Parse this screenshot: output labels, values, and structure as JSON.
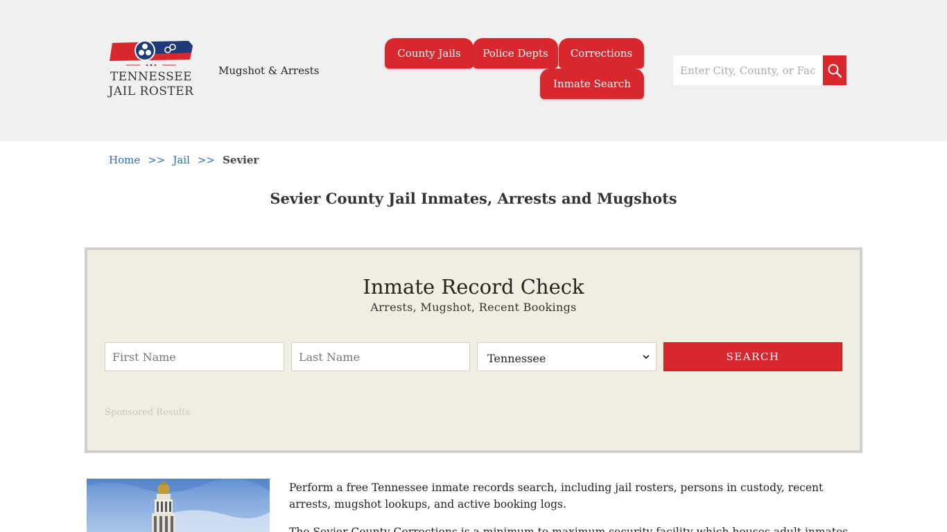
{
  "header": {
    "logo": {
      "line1": "TENNESSEE",
      "line2": "JAIL ROSTER"
    },
    "tagline": "Mugshot & Arrests",
    "nav": [
      {
        "label": "County Jails"
      },
      {
        "label": "Police Depts"
      },
      {
        "label": "Corrections"
      },
      {
        "label": "Inmate Search"
      }
    ],
    "search": {
      "placeholder": "Enter City, County, or Facility",
      "icon": "search-icon"
    }
  },
  "breadcrumb": {
    "home": "Home",
    "sep": ">>",
    "jail": "Jail",
    "current": "Sevier"
  },
  "page_title": "Sevier County Jail Inmates, Arrests and Mugshots",
  "record_check": {
    "title": "Inmate Record Check",
    "subtitle": "Arrests, Mugshot, Recent Bookings",
    "first_name_placeholder": "First Name",
    "last_name_placeholder": "Last Name",
    "state_selected": "Tennessee",
    "button": "SEARCH",
    "sponsored": "Sponsored Results"
  },
  "content": {
    "p1": "Perform a free Tennessee inmate records search, including jail rosters, persons in custody, recent arrests, mugshot lookups, and active booking logs.",
    "p2": "The Sevier County Corrections is a minimum to maximum security facility which houses adult inmates and"
  },
  "colors": {
    "accent": "#d9272e",
    "link": "#2a6bbf",
    "panel_bg": "#f0eee0",
    "header_bg": "#f0f0f0"
  }
}
